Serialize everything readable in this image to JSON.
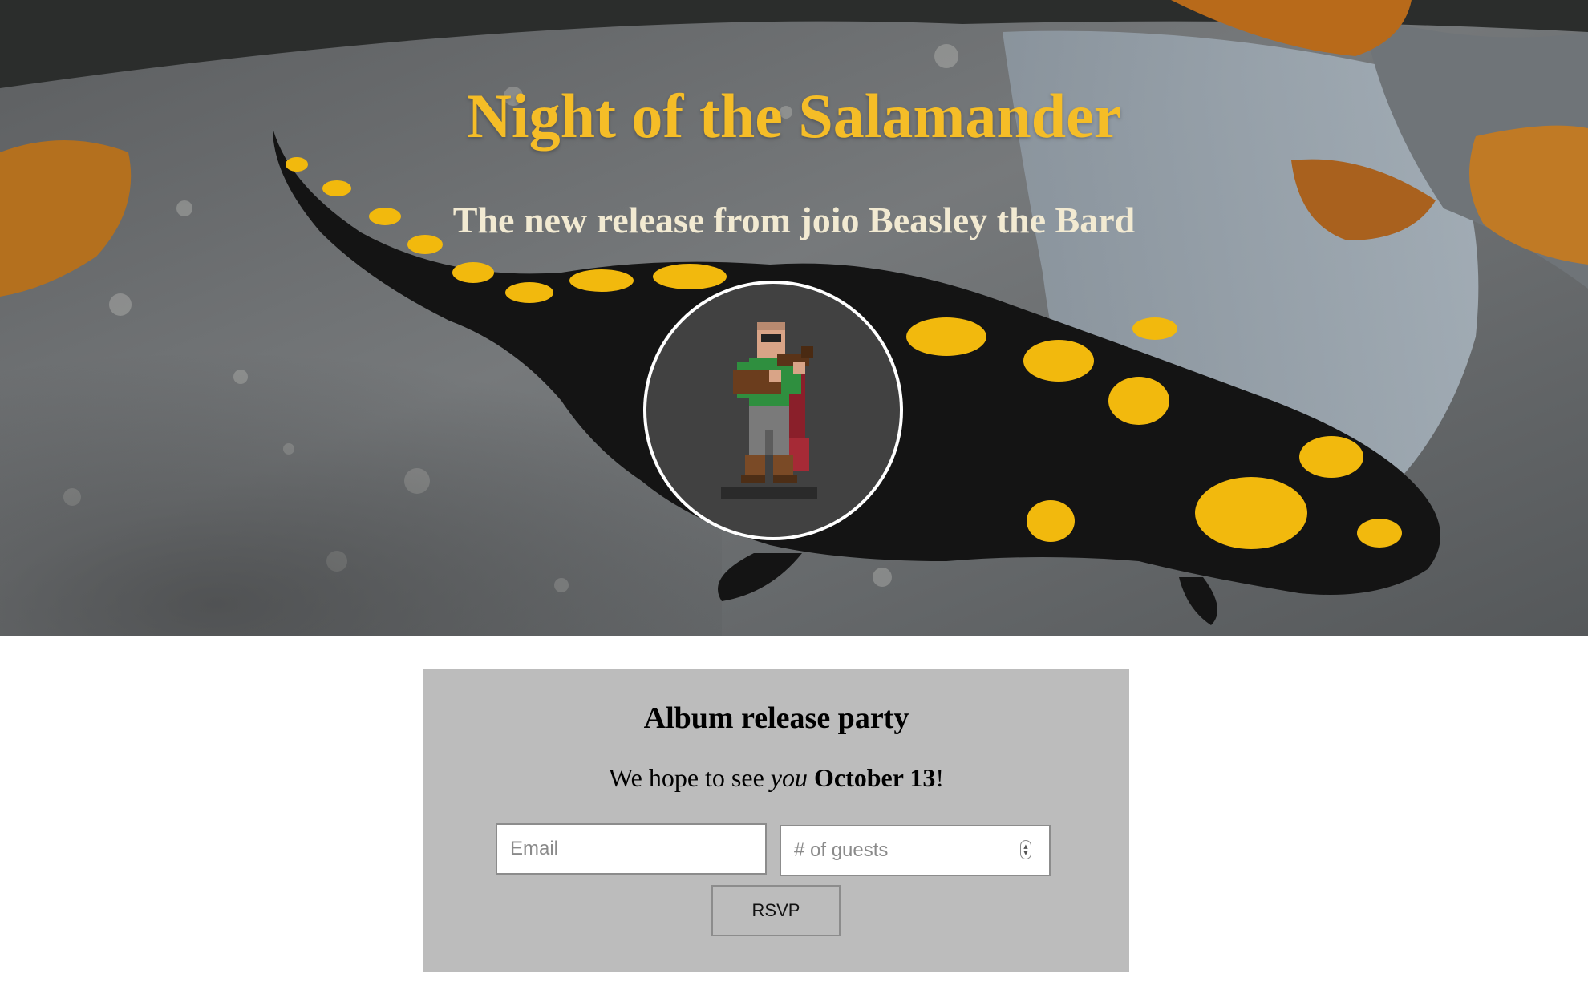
{
  "hero": {
    "title": "Night of the Salamander",
    "subtitle": "The new release from joio Beasley the Bard",
    "background_image": "fire-salamander-on-rock-photo",
    "avatar_icon": "bard-with-lute-pixel-art-icon",
    "colors": {
      "title": "#f5bd27",
      "subtitle": "#f2ead2"
    }
  },
  "rsvp": {
    "heading": "Album release party",
    "message": {
      "prefix": "We hope to see ",
      "emphasis": "you",
      "space": " ",
      "date": "October 13",
      "suffix": "!"
    },
    "email_placeholder": "Email",
    "guests_placeholder": "# of guests",
    "button_label": "RSVP",
    "colors": {
      "card_background": "#bcbcbc"
    }
  }
}
